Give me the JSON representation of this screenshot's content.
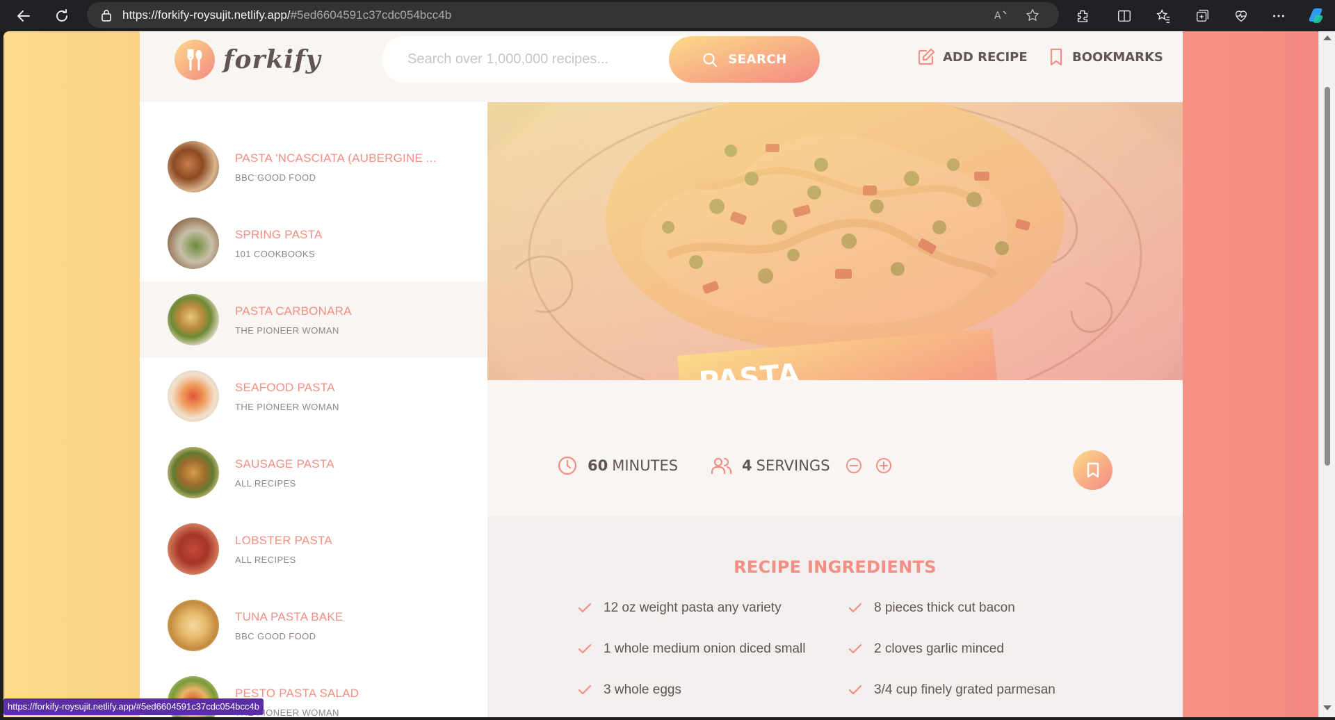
{
  "browser": {
    "url_host": "https://forkify-roysujit.netlify.app/",
    "url_hash": "#5ed6604591c37cdc054bcc4b",
    "status_url": "https://forkify-roysujit.netlify.app/#5ed6604591c37cdc054bcc4b"
  },
  "header": {
    "logo": "forkify",
    "search_placeholder": "Search over 1,000,000 recipes...",
    "search_label": "SEARCH",
    "add_recipe_label": "ADD RECIPE",
    "bookmarks_label": "BOOKMARKS"
  },
  "results": [
    {
      "title": "PASTA 'NCASCIATA (AUBERGINE ...",
      "publisher": "BBC GOOD FOOD"
    },
    {
      "title": "SPRING PASTA",
      "publisher": "101 COOKBOOKS"
    },
    {
      "title": "PASTA CARBONARA",
      "publisher": "THE PIONEER WOMAN",
      "active": true
    },
    {
      "title": "SEAFOOD PASTA",
      "publisher": "THE PIONEER WOMAN"
    },
    {
      "title": "SAUSAGE PASTA",
      "publisher": "ALL RECIPES"
    },
    {
      "title": "LOBSTER PASTA",
      "publisher": "ALL RECIPES"
    },
    {
      "title": "TUNA PASTA BAKE",
      "publisher": "BBC GOOD FOOD"
    },
    {
      "title": "PESTO PASTA SALAD",
      "publisher": "THE PIONEER WOMAN"
    }
  ],
  "recipe": {
    "title": "PASTA CARBONARA",
    "minutes": "60",
    "minutes_label": "MINUTES",
    "servings": "4",
    "servings_label": "SERVINGS",
    "ingredients_heading": "RECIPE INGREDIENTS",
    "ingredients": [
      "12 oz weight pasta any variety",
      "8 pieces thick cut bacon",
      "1 whole medium onion diced small",
      "2 cloves garlic minced",
      "3 whole eggs",
      "3/4 cup finely grated parmesan"
    ]
  },
  "colors": {
    "accent": "#f38e82",
    "gradient_start": "#fbdb89",
    "gradient_end": "#f48982",
    "text": "#615551"
  }
}
